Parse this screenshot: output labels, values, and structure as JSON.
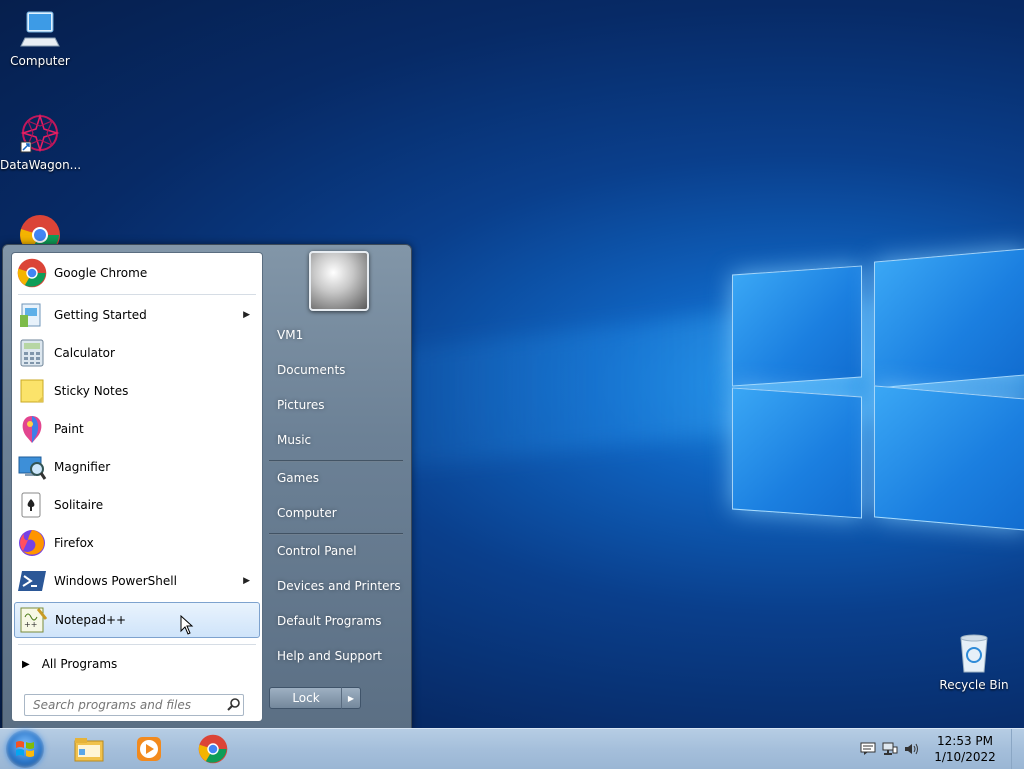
{
  "desktop": {
    "icons": [
      {
        "label": "Computer"
      },
      {
        "label": "DataWagon..."
      },
      {
        "label": ""
      },
      {
        "label": "Recycle Bin"
      }
    ]
  },
  "start_menu": {
    "programs": [
      {
        "label": "Google Chrome",
        "icon": "chrome-icon",
        "submenu": false
      },
      {
        "label": "Getting Started",
        "icon": "getting-started-icon",
        "submenu": true
      },
      {
        "label": "Calculator",
        "icon": "calculator-icon",
        "submenu": false
      },
      {
        "label": "Sticky Notes",
        "icon": "sticky-notes-icon",
        "submenu": false
      },
      {
        "label": "Paint",
        "icon": "paint-icon",
        "submenu": false
      },
      {
        "label": "Magnifier",
        "icon": "magnifier-icon",
        "submenu": false
      },
      {
        "label": "Solitaire",
        "icon": "solitaire-icon",
        "submenu": false
      },
      {
        "label": "Firefox",
        "icon": "firefox-icon",
        "submenu": false
      },
      {
        "label": "Windows PowerShell",
        "icon": "powershell-icon",
        "submenu": true
      },
      {
        "label": "Notepad++",
        "icon": "notepadpp-icon",
        "submenu": false,
        "highlighted": true
      }
    ],
    "all_programs": "All Programs",
    "search_placeholder": "Search programs and files",
    "right_items": [
      {
        "label": "VM1"
      },
      {
        "label": "Documents"
      },
      {
        "label": "Pictures"
      },
      {
        "label": "Music"
      },
      {
        "label": "Games"
      },
      {
        "label": "Computer"
      },
      {
        "label": "Control Panel"
      },
      {
        "label": "Devices and Printers"
      },
      {
        "label": "Default Programs"
      },
      {
        "label": "Help and Support"
      }
    ],
    "lock_label": "Lock"
  },
  "taskbar": {
    "pinned": [
      "file-explorer-icon",
      "media-player-icon",
      "chrome-icon"
    ],
    "clock_time": "12:53 PM",
    "clock_date": "1/10/2022"
  },
  "colors": {
    "desktop_bg": "#0a3f8c",
    "taskbar": "#a5bfdb",
    "hover": "#cfe4fa"
  }
}
